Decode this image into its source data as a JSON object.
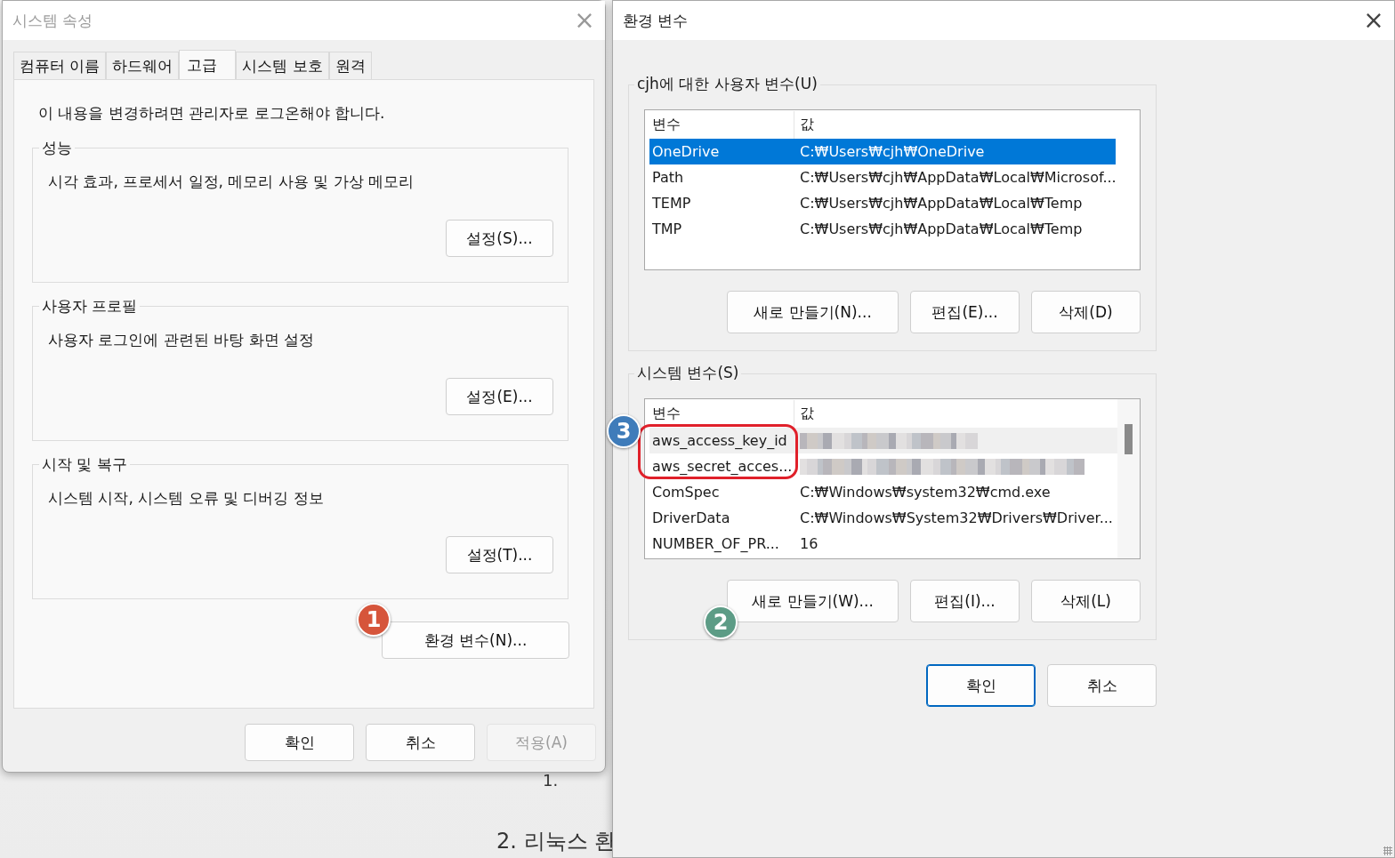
{
  "background_page": {
    "texts": [
      "1.",
      "2. 리눅스 환"
    ]
  },
  "system_properties": {
    "title": "시스템 속성",
    "close": "×",
    "tabs": [
      {
        "label": "컴퓨터 이름",
        "selected": false
      },
      {
        "label": "하드웨어",
        "selected": false
      },
      {
        "label": "고급",
        "selected": true
      },
      {
        "label": "시스템 보호",
        "selected": false
      },
      {
        "label": "원격",
        "selected": false
      }
    ],
    "notice": "이 내용을 변경하려면 관리자로 로그온해야 합니다.",
    "groups": [
      {
        "title": "성능",
        "description": "시각 효과, 프로세서 일정, 메모리 사용 및 가상 메모리",
        "button": "설정(S)..."
      },
      {
        "title": "사용자 프로필",
        "description": "사용자 로그인에 관련된 바탕 화면 설정",
        "button": "설정(E)..."
      },
      {
        "title": "시작 및 복구",
        "description": "시스템 시작, 시스템 오류 및 디버깅 정보",
        "button": "설정(T)..."
      }
    ],
    "env_button": "환경 변수(N)...",
    "buttons": [
      {
        "label": "확인",
        "disabled": false
      },
      {
        "label": "취소",
        "disabled": false
      },
      {
        "label": "적용(A)",
        "disabled": true
      }
    ]
  },
  "environment_variables": {
    "title": "환경 변수",
    "close": "×",
    "sections": [
      {
        "title": "cjh에 대한 사용자 변수(U)",
        "focused": true,
        "scrollbar": false,
        "columns": [
          "변수",
          "값"
        ],
        "rows": [
          {
            "name": "OneDrive",
            "value": "C:₩Users₩cjh₩OneDrive",
            "selected": true,
            "redacted": false
          },
          {
            "name": "Path",
            "value": "C:₩Users₩cjh₩AppData₩Local₩Microsof...",
            "selected": false,
            "redacted": false
          },
          {
            "name": "TEMP",
            "value": "C:₩Users₩cjh₩AppData₩Local₩Temp",
            "selected": false,
            "redacted": false
          },
          {
            "name": "TMP",
            "value": "C:₩Users₩cjh₩AppData₩Local₩Temp",
            "selected": false,
            "redacted": false
          }
        ],
        "buttons": [
          "새로 만들기(N)...",
          "편집(E)...",
          "삭제(D)"
        ]
      },
      {
        "title": "시스템 변수(S)",
        "focused": false,
        "scrollbar": true,
        "columns": [
          "변수",
          "값"
        ],
        "rows": [
          {
            "name": "aws_access_key_id",
            "selected": true,
            "redacted": true
          },
          {
            "name": "aws_secret_acces...",
            "selected": false,
            "redacted": true
          },
          {
            "name": "ComSpec",
            "value": "C:₩Windows₩system32₩cmd.exe",
            "selected": false,
            "redacted": false
          },
          {
            "name": "DriverData",
            "value": "C:₩Windows₩System32₩Drivers₩Driver...",
            "selected": false,
            "redacted": false
          },
          {
            "name": "NUMBER_OF_PR...",
            "value": "16",
            "selected": false,
            "redacted": false
          }
        ],
        "buttons": [
          "새로 만들기(W)...",
          "편집(I)...",
          "삭제(L)"
        ]
      }
    ],
    "buttons": [
      {
        "label": "확인",
        "default": true
      },
      {
        "label": "취소",
        "default": false
      }
    ]
  },
  "annotations": [
    {
      "label": "1",
      "color": "#d6553b"
    },
    {
      "label": "2",
      "color": "#5d9c86"
    },
    {
      "label": "3",
      "color": "#3f7cba"
    }
  ]
}
